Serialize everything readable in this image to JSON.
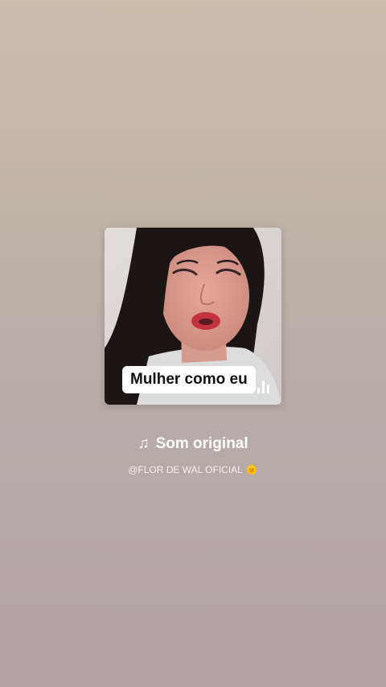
{
  "cover": {
    "caption": "Mulher como eu",
    "playing_indicator_icon": "audio-bars-icon"
  },
  "sound": {
    "note_icon": "♫",
    "title": "Som original"
  },
  "author": {
    "handle": "@FLOR DE WAL OFICIAL",
    "emoji": "🌞"
  },
  "colors": {
    "background_top": "#cbbdaa",
    "background_bottom": "#b3a3a2",
    "title_text": "#ffffff"
  }
}
